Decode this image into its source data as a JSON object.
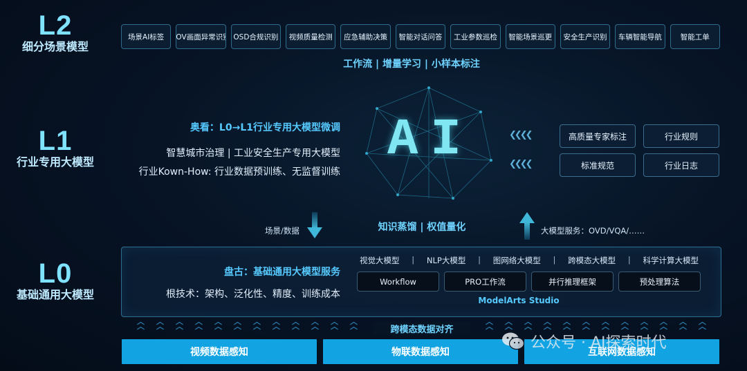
{
  "levels": {
    "l2": {
      "code": "L2",
      "name": "细分场景模型"
    },
    "l1": {
      "code": "L1",
      "name": "行业专用大模型"
    },
    "l0": {
      "code": "L0",
      "name": "基础通用大模型"
    }
  },
  "l2": {
    "scenes": [
      "场景AI标签",
      "FOV画面异常识别",
      "OSD合规识别",
      "视频质量检测",
      "应急辅助决策",
      "智能对话问答",
      "工业参数巡检",
      "智能场景巡更",
      "安全生产识别",
      "车辆智能导航",
      "智能工单"
    ],
    "subtitle": "工作流 | 增量学习 | 小样本标注"
  },
  "l1": {
    "title": "奥看：L0→L1行业专用大模型微调",
    "line1": "智慧城市治理 | 工业安全生产专用大模型",
    "line2": "行业Kown-How: 行业数据预训练、无监督训练",
    "ai_label": "AI",
    "right_buttons": [
      "高质量专家标注",
      "行业规则",
      "标准规范",
      "行业日志"
    ]
  },
  "middle": {
    "down_label": "场景/数据",
    "center_label": "知识蒸馏 | 权值量化",
    "up_label": "大模型服务：OVD/VQA/……"
  },
  "l0": {
    "title": "盘古：基础通用大模型服务",
    "root_tech": "根技术：架构、泛化性、精度、训练成本",
    "models": [
      "视觉大模型",
      "NLP大模型",
      "图网络大模型",
      "跨模态大模型",
      "科学计算大模型"
    ],
    "tools": [
      "Workflow",
      "PRO工作流",
      "并行推理框架",
      "预处理算法"
    ],
    "platform": "ModelArts Studio"
  },
  "align_label": "跨模态数据对齐",
  "sources": [
    "视频数据感知",
    "物联数据感知",
    "互联网数据感知"
  ],
  "watermark": "公众号 · AI探索时代",
  "icons": {
    "wechat": "wechat-icon",
    "down_arrow": "arrow-down-icon",
    "up_arrow": "arrow-up-icon",
    "chevrons": "double-chevron-left-icon"
  },
  "colors": {
    "accent": "#12a3e3",
    "title_blue": "#56c9ff",
    "level_code": "#7fe3ff"
  }
}
